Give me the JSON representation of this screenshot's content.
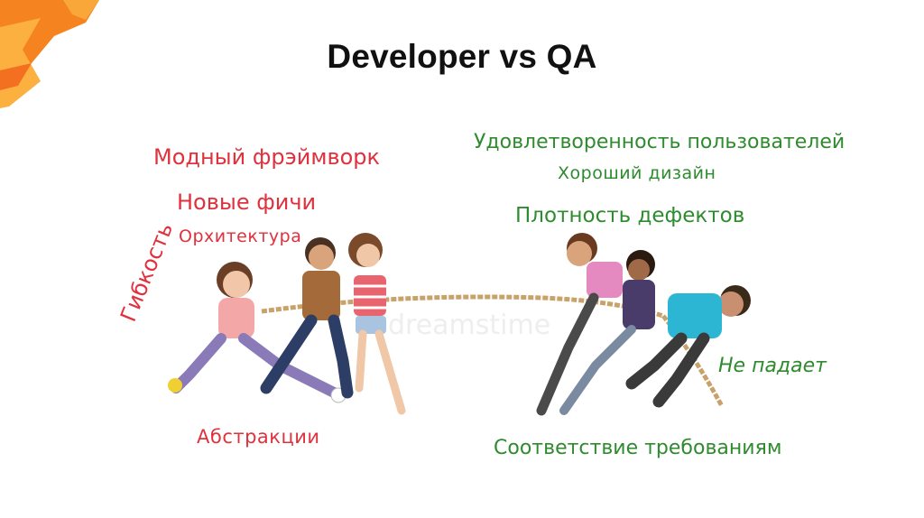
{
  "slide": {
    "title": "Developer vs QA",
    "accent_color": "#f5831f",
    "accent_light": "#fbb040"
  },
  "developer_side": {
    "color": "#e0313d",
    "items": [
      "Модный фрэймворк",
      "Новые фичи",
      "Орхитектура",
      "Гибкость",
      "Абстракции"
    ]
  },
  "qa_side": {
    "color": "#2e8b2e",
    "items": [
      "Удовлетворенность пользователей",
      "Хороший дизайн",
      "Плотность дефектов",
      "Не падает",
      "Соответствие требованиям"
    ]
  },
  "illustration": {
    "subject": "children-tug-of-war",
    "watermark": "dreamstime"
  }
}
